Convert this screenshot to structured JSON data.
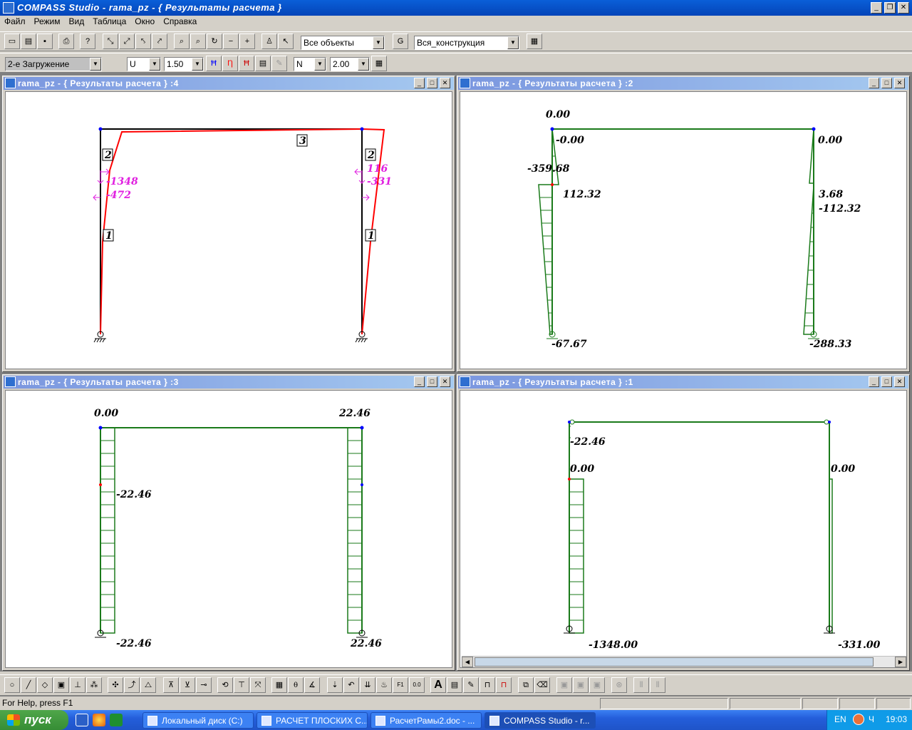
{
  "app": {
    "title": "COMPASS  Studio - rama_pz - { Результаты расчета }",
    "menu": [
      "Файл",
      "Режим",
      "Вид",
      "Таблица",
      "Окно",
      "Справка"
    ]
  },
  "toolbar1": {
    "objects_combo": "Все объекты",
    "construction_combo": "Вся_конструкция"
  },
  "toolbar2": {
    "loadcase_combo": "2-е Загружение",
    "displacement_combo": "U",
    "displacement_scale": "1.50",
    "force_combo": "N",
    "force_scale": "2.00"
  },
  "windows": {
    "w4": {
      "title": "rama_pz - { Результаты расчета } :4",
      "member_labels": [
        "2",
        "2",
        "3",
        "1",
        "1"
      ],
      "reactions": {
        "left_top": "-1348",
        "left_bottom": "-472",
        "right_top": "116",
        "right_bottom": "-331"
      }
    },
    "w2": {
      "title": "rama_pz - { Результаты расчета } :2",
      "values": {
        "left_top": "0.00",
        "left_top2": "-0.00",
        "left_mid1": "-359.68",
        "left_mid2": "112.32",
        "left_bottom": "-67.67",
        "right_top": "0.00",
        "right_mid1": "3.68",
        "right_mid2": "-112.32",
        "right_bottom": "-288.33"
      }
    },
    "w3": {
      "title": "rama_pz - { Результаты расчета } :3",
      "values": {
        "left_top": "0.00",
        "right_top": "22.46",
        "left_mid": "-22.46",
        "left_bottom": "-22.46",
        "right_bottom": "22.46"
      }
    },
    "w1": {
      "title": "rama_pz - { Результаты расчета } :1",
      "values": {
        "left_top": "-22.46",
        "left_mid": "0.00",
        "right_mid": "0.00",
        "left_bottom": "-1348.00",
        "right_bottom": "-331.00"
      }
    }
  },
  "status": {
    "help": "For Help, press F1"
  },
  "taskbar": {
    "start": "пуск",
    "tasks": [
      "Локальный диск (C:)",
      "РАСЧЕТ ПЛОСКИХ С...",
      "РасчетРамы2.doc - ...",
      "COMPASS  Studio - r..."
    ],
    "lang": "EN",
    "clock": "19:03",
    "tray_extra": "Ч"
  },
  "colors": {
    "frame": "#000000",
    "deformed": "#ff0000",
    "diagram": "#1a7a1a",
    "reaction": "#e020e0",
    "node": "#0000ff"
  }
}
